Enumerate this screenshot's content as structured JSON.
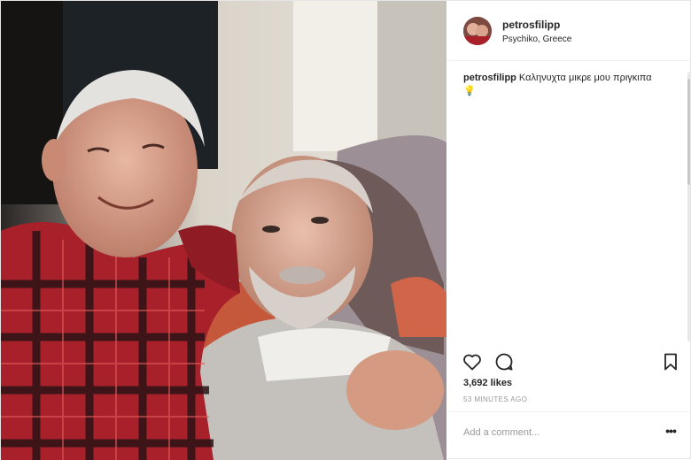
{
  "post": {
    "username": "petrosfilipp",
    "location": "Psychiko, Greece",
    "caption": {
      "username": "petrosfilipp",
      "text": "Καληνυχτα μικρε μου πριγκιπα",
      "emoji": "💡"
    },
    "likes": "3,692 likes",
    "time": "53 MINUTES AGO",
    "comment_placeholder": "Add a comment...",
    "more_label": "•••"
  },
  "icons": {
    "like": "heart-icon",
    "comment": "comment-bubble-icon",
    "save": "bookmark-icon",
    "more": "more-options-icon"
  },
  "colors": {
    "text": "#262626",
    "secondary": "#999999",
    "divider": "#efefef"
  }
}
